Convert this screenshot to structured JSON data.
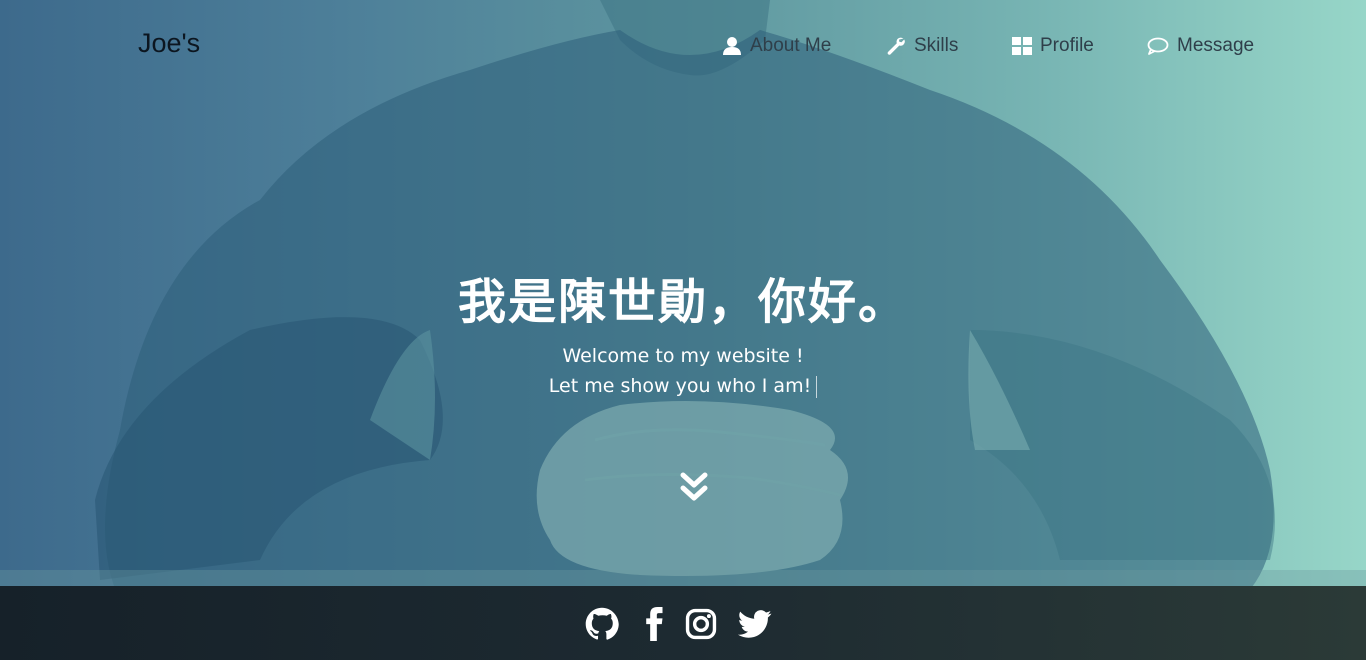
{
  "navbar": {
    "brand": "Joe's",
    "items": [
      {
        "label": "About Me",
        "icon": "user-icon"
      },
      {
        "label": "Skills",
        "icon": "wrench-icon"
      },
      {
        "label": "Profile",
        "icon": "grid-icon"
      },
      {
        "label": "Message",
        "icon": "chat-bubble-icon"
      }
    ]
  },
  "hero": {
    "headline": "我是陳世勛，你好。",
    "welcome": "Welcome to my website !",
    "tagline": "Let me show you who I am!",
    "scroll_icon": "double-chevron-down-icon"
  },
  "footer": {
    "social": [
      {
        "name": "github-icon"
      },
      {
        "name": "facebook-icon"
      },
      {
        "name": "instagram-icon"
      },
      {
        "name": "twitter-icon"
      }
    ]
  },
  "colors": {
    "gradient_left": "#3d6a8c",
    "gradient_right": "#97d6c8",
    "nav_text": "#2f3f4a",
    "brand_text": "#0c1620",
    "footer_bg": "#1d2a31"
  }
}
